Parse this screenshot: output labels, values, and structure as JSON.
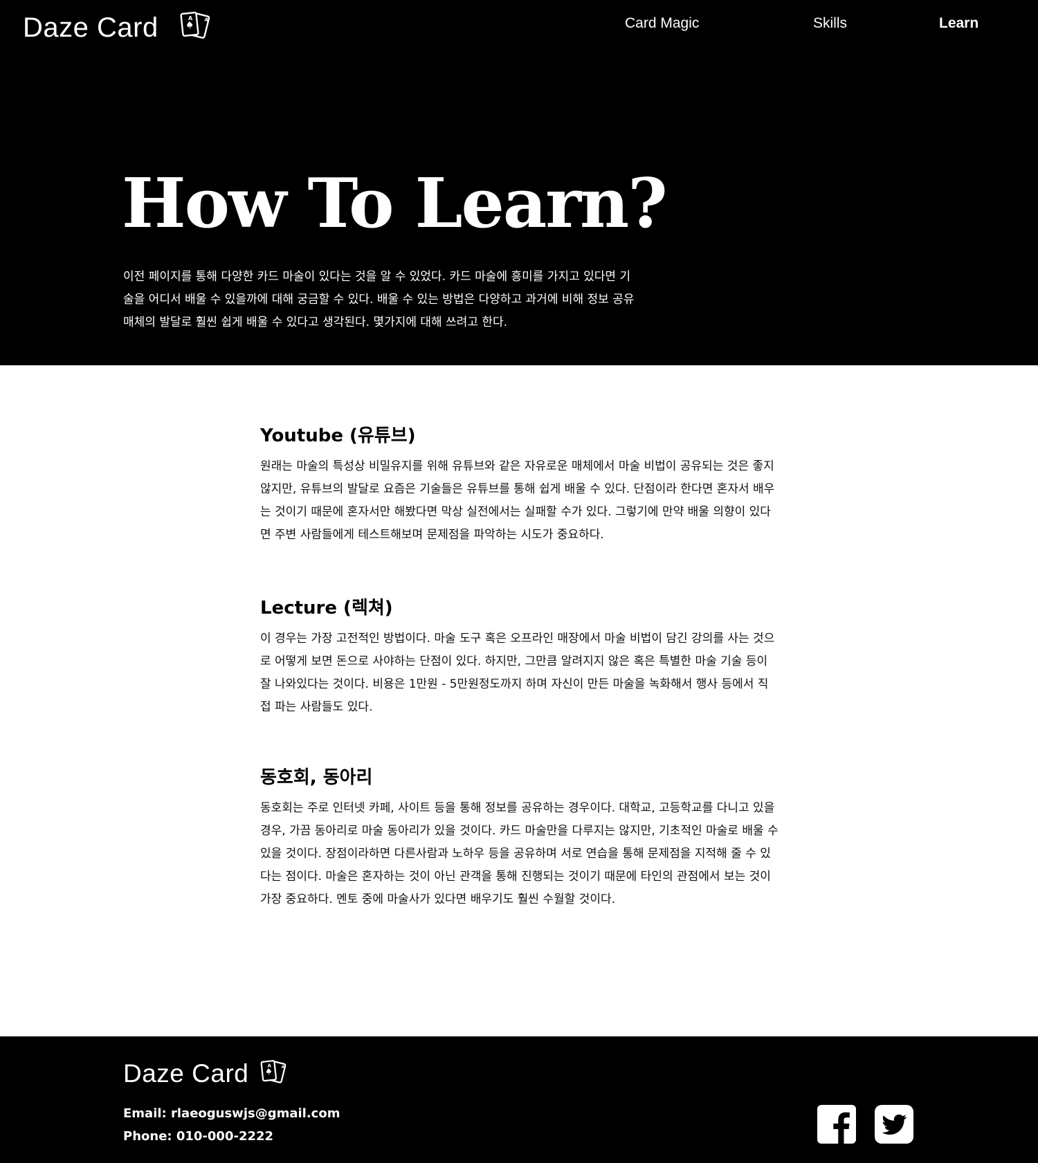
{
  "header": {
    "brand": "Daze Card",
    "brand_icon": "playing-cards-icon",
    "nav": [
      {
        "label": "Card Magic",
        "active": false
      },
      {
        "label": "Skills",
        "active": false
      },
      {
        "label": "Learn",
        "active": true
      }
    ]
  },
  "hero": {
    "title": "How To Learn?",
    "intro": "이전 페이지를 통해 다양한 카드 마술이 있다는 것을 알 수 있었다. 카드 마술에 흥미를 가지고 있다면 기술을 어디서 배울 수 있을까에 대해 궁금할 수 있다. 배울 수 있는 방법은 다양하고 과거에 비해 정보 공유 매체의 발달로 훨씬 쉽게 배울 수 있다고 생각된다. 몇가지에 대해 쓰려고 한다."
  },
  "sections": [
    {
      "heading": "Youtube (유튜브)",
      "body": "원래는 마술의 특성상 비밀유지를 위해 유튜브와 같은 자유로운 매체에서 마술 비법이 공유되는 것은 좋지 않지만, 유튜브의 발달로 요즘은 기술들은 유튜브를 통해 쉽게 배울 수 있다. 단점이라 한다면 혼자서 배우는 것이기 때문에 혼자서만 해봤다면 막상 실전에서는 실패할 수가 있다. 그렇기에 만약 배울 의향이 있다면 주변 사람들에게 테스트해보며 문제점을 파악하는 시도가 중요하다."
    },
    {
      "heading": "Lecture (렉쳐)",
      "body": "이 경우는 가장 고전적인 방법이다. 마술 도구 혹은 오프라인 매장에서 마술 비법이 담긴 강의를 사는 것으로 어떻게 보면 돈으로 사야하는 단점이 있다. 하지만, 그만큼 알려지지 않은 혹은 특별한 마술 기술 등이 잘 나와있다는 것이다. 비용은 1만원 - 5만원정도까지 하며 자신이 만든 마술을 녹화해서 행사 등에서 직접 파는 사람들도 있다."
    },
    {
      "heading": "동호회, 동아리",
      "body": "동호회는 주로 인터넷 카페, 사이트 등을 통해 정보를 공유하는 경우이다. 대학교, 고등학교를 다니고 있을 경우, 가끔 동아리로 마술 동아리가 있을 것이다. 카드 마술만을 다루지는 않지만, 기초적인 마술로 배울 수 있을 것이다. 장점이라하면 다른사람과 노하우 등을 공유하며 서로 연습을 통해 문제점을 지적해 줄 수 있다는 점이다. 마술은 혼자하는 것이 아닌 관객을 통해 진행되는 것이기 때문에 타인의 관점에서 보는 것이 가장 중요하다. 멘토 중에 마술사가 있다면 배우기도 훨씬 수월할 것이다."
    }
  ],
  "footer": {
    "brand": "Daze Card",
    "email": "Email: rlaeoguswjs@gmail.com",
    "phone": "Phone: 010-000-2222",
    "social": [
      {
        "icon": "facebook-icon"
      },
      {
        "icon": "twitter-icon"
      }
    ]
  },
  "colors": {
    "background_dark": "#000000",
    "background_light": "#ffffff",
    "text_light": "#ffffff",
    "text_dark": "#000000"
  }
}
